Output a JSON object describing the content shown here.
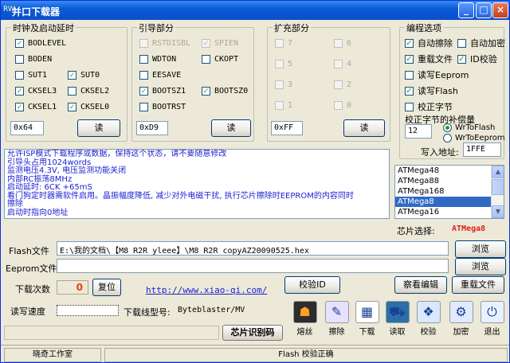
{
  "window": {
    "title": "并口下载器",
    "sys_icon": "RW",
    "min": "_",
    "max": "□",
    "close": "×"
  },
  "clock_group": {
    "label": "时钟及启动延时",
    "items": [
      {
        "label": "BODLEVEL",
        "checked": true
      },
      {
        "label": "BODEN",
        "checked": false
      },
      {
        "label": "SUT1",
        "checked": false
      },
      {
        "label": "SUT0",
        "checked": true
      },
      {
        "label": "CKSEL3",
        "checked": true
      },
      {
        "label": "CKSEL2",
        "checked": false
      },
      {
        "label": "CKSEL1",
        "checked": true
      },
      {
        "label": "CKSEL0",
        "checked": true
      }
    ],
    "value": "0x64",
    "read_label": "读"
  },
  "boot_group": {
    "label": "引导部分",
    "items": [
      {
        "label": "RSTDISBL",
        "checked": false,
        "disabled": true
      },
      {
        "label": "SPIEN",
        "checked": true,
        "disabled": true
      },
      {
        "label": "WDTON",
        "checked": false
      },
      {
        "label": "CKOPT",
        "checked": false
      },
      {
        "label": "EESAVE",
        "checked": false
      },
      {
        "label": "BOOTSZ1",
        "checked": true
      },
      {
        "label": "BOOTSZ0",
        "checked": true
      },
      {
        "label": "BOOTRST",
        "checked": false
      }
    ],
    "value": "0xD9",
    "read_label": "读"
  },
  "ext_group": {
    "label": "扩充部分",
    "items": [
      {
        "label": "7"
      },
      {
        "label": "6"
      },
      {
        "label": "5"
      },
      {
        "label": "4"
      },
      {
        "label": "3"
      },
      {
        "label": "2"
      },
      {
        "label": "1"
      },
      {
        "label": "0"
      }
    ],
    "value": "0xFF",
    "read_label": "读"
  },
  "prog_group": {
    "label": "编程选项",
    "items": [
      {
        "label": "自动擦除",
        "checked": true
      },
      {
        "label": "自动加密",
        "checked": false
      },
      {
        "label": "重载文件",
        "checked": true
      },
      {
        "label": "ID校验",
        "checked": true
      },
      {
        "label": "读写Eeprom",
        "checked": false
      },
      {
        "label": "读写Flash",
        "checked": true
      },
      {
        "label": "校正字节",
        "checked": false
      }
    ],
    "compensation_label": "校正字节的补偿量",
    "compensation_value": "12",
    "radio1": "WrToFlash",
    "radio2": "WrToEeprom",
    "write_addr_label": "写入地址:",
    "write_addr": "1FFE"
  },
  "log": {
    "lines": [
      "允许ISP模式下载程序或数据，保持这个状态，请不要随意修改",
      "引导头占用1024words",
      "监测电压4.3V, 电压监测功能关闭",
      "内部RC振荡8MHz",
      "启动延时: 6CK +65mS",
      "看门狗定时器需软件启用。晶振幅度降低, 减少对外电磁干扰, 执行芯片擦除时EEPROM的内容同时",
      "擦除",
      "启动时指向0地址"
    ]
  },
  "chip_list": {
    "items": [
      "ATMega48",
      "ATMega88",
      "ATMega168",
      "ATMega8",
      "ATMega16"
    ],
    "selected_index": 3,
    "select_label": "芯片选择:",
    "selected": "ATMega8",
    "selected_color": "#e02020"
  },
  "files": {
    "flash_label": "Flash文件",
    "flash_path": "E:\\我的文档\\【M8_R2R_yleee】\\M8_R2R_copyAZ20090525.hex",
    "eeprom_label": "Eeprom文件",
    "eeprom_path": "",
    "browse1": "浏览",
    "browse2": "浏览"
  },
  "download": {
    "count_label": "下载次数",
    "count": "0",
    "reset": "复位",
    "url": "http://www.xiao-qi.com/",
    "verify_id": "校验ID",
    "view_edit": "察看编辑",
    "reload": "重载文件",
    "speed_label": "读写速度",
    "cable_label": "下载线型号:",
    "cable_value": "Byteblaster/MV",
    "chip_identify": "芯片识别码"
  },
  "toolbar": [
    {
      "label": "熔丝",
      "icon": "fuse-icon",
      "glyph": "☗"
    },
    {
      "label": "擦除",
      "icon": "erase-icon",
      "glyph": "✎"
    },
    {
      "label": "下载",
      "icon": "download-icon",
      "glyph": "▦"
    },
    {
      "label": "读取",
      "icon": "read-icon",
      "glyph": "⛟"
    },
    {
      "label": "校验",
      "icon": "verify-icon",
      "glyph": "❖"
    },
    {
      "label": "加密",
      "icon": "encrypt-icon",
      "glyph": "⚙"
    },
    {
      "label": "退出",
      "icon": "exit-icon",
      "glyph": "⏻"
    }
  ],
  "status": {
    "left": "晓奇工作室",
    "middle": "Flash 校验正确"
  }
}
